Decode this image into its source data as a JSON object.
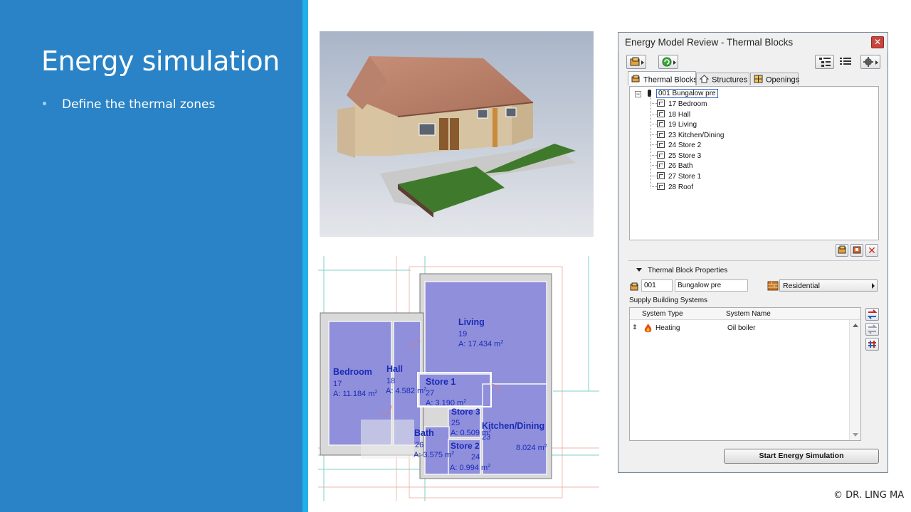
{
  "slide": {
    "title": "Energy simulation",
    "bullets": [
      "Define the thermal zones"
    ],
    "copyright": "© DR. LING MA"
  },
  "dialog": {
    "title": "Energy Model Review - Thermal Blocks",
    "close_icon": "close-icon",
    "tabs": [
      {
        "label": "Thermal Blocks",
        "icon": "thermal-block-icon",
        "active": true
      },
      {
        "label": "Structures",
        "icon": "house-icon",
        "active": false
      },
      {
        "label": "Openings",
        "icon": "window-icon",
        "active": false
      }
    ],
    "tree": {
      "root": "001 Bungalow pre",
      "children": [
        "17 Bedroom",
        "18 Hall",
        "19 Living",
        "23 Kitchen/Dining",
        "24 Store 2",
        "25 Store 3",
        "26 Bath",
        "27 Store 1",
        "28 Roof"
      ]
    },
    "properties": {
      "header": "Thermal Block Properties",
      "id": "001",
      "name": "Bungalow pre",
      "type": "Residential"
    },
    "supply": {
      "header": "Supply Building Systems",
      "col_type": "System Type",
      "col_name": "System Name",
      "rows": [
        {
          "type": "Heating",
          "name": "Oil boiler"
        }
      ]
    },
    "start_button": "Start Energy Simulation"
  },
  "plan": {
    "rooms": [
      {
        "name": "Living",
        "num": "19",
        "area": "A: 17.434 m"
      },
      {
        "name": "Bedroom",
        "num": "17",
        "area": "A: 11.184 m"
      },
      {
        "name": "Hall",
        "num": "18",
        "area": "A: 4.582 m"
      },
      {
        "name": "Store 1",
        "num": "27",
        "area": "A: 3.190 m"
      },
      {
        "name": "Store 3",
        "num": "25",
        "area": "A: 0.509 m"
      },
      {
        "name": "Kitchen/Dining",
        "num": "23",
        "area": "8.024 m"
      },
      {
        "name": "Bath",
        "num": "26",
        "area": "A: 3.575 m"
      },
      {
        "name": "Store 2",
        "num": "24",
        "area": "A: 0.994 m"
      }
    ],
    "area_sup": "2"
  },
  "colors": {
    "panel_blue": "#2a83c6",
    "stripe": "#1fb0e8",
    "room_fill": "#8f8fdc",
    "room_label": "#1a2bb5"
  }
}
